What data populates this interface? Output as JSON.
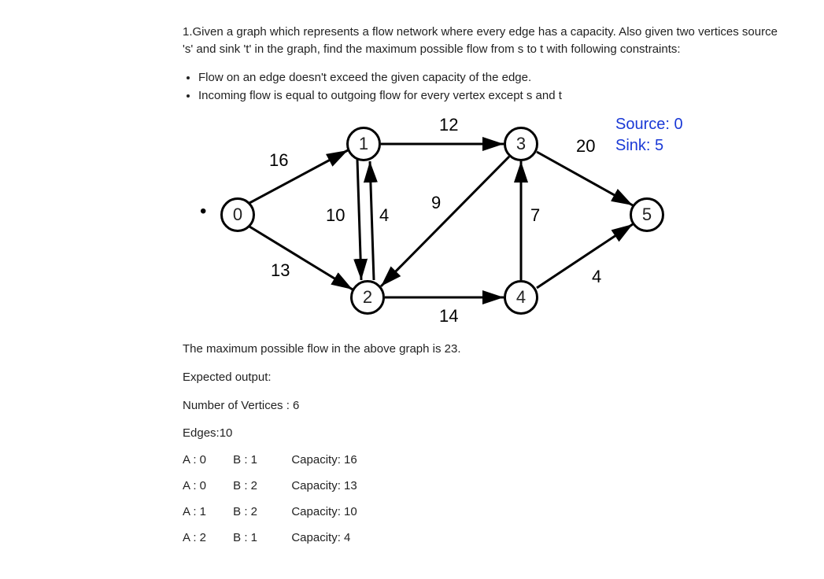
{
  "problem": {
    "intro": "1.Given a graph which represents a flow network where every edge has a capacity. Also given two vertices source 's' and sink 't' in the graph, find the maximum possible flow from s to t with following constraints:",
    "constraints": [
      "Flow on an edge doesn't exceed the given capacity of the edge.",
      "Incoming flow is equal to outgoing flow for every vertex except s and t"
    ]
  },
  "diagram": {
    "source_label": "Source: 0",
    "sink_label": "Sink: 5",
    "nodes": {
      "n0": "0",
      "n1": "1",
      "n2": "2",
      "n3": "3",
      "n4": "4",
      "n5": "5"
    },
    "edge_weights": {
      "e0_1": "16",
      "e0_2": "13",
      "e1_2": "10",
      "e2_1": "4",
      "e1_3": "12",
      "e3_2": "9",
      "e2_4": "14",
      "e4_3": "7",
      "e3_5": "20",
      "e4_5": "4"
    }
  },
  "result": {
    "maxflow_text": "The maximum possible flow in the above graph is 23.",
    "expected_label": "Expected output:",
    "vertices_line": "Number of Vertices : 6",
    "edges_line": "Edges:10",
    "edges_table": [
      {
        "a": "A : 0",
        "b": "B : 1",
        "cap": "Capacity: 16"
      },
      {
        "a": "A : 0",
        "b": "B : 2",
        "cap": "Capacity: 13"
      },
      {
        "a": "A : 1",
        "b": "B : 2",
        "cap": "Capacity: 10"
      },
      {
        "a": "A : 2",
        "b": "B : 1",
        "cap": "Capacity: 4"
      }
    ]
  },
  "chart_data": {
    "type": "diagram",
    "graph_kind": "directed_flow_network",
    "source": 0,
    "sink": 5,
    "vertices": [
      0,
      1,
      2,
      3,
      4,
      5
    ],
    "edges": [
      {
        "from": 0,
        "to": 1,
        "capacity": 16
      },
      {
        "from": 0,
        "to": 2,
        "capacity": 13
      },
      {
        "from": 1,
        "to": 2,
        "capacity": 10
      },
      {
        "from": 2,
        "to": 1,
        "capacity": 4
      },
      {
        "from": 1,
        "to": 3,
        "capacity": 12
      },
      {
        "from": 3,
        "to": 2,
        "capacity": 9
      },
      {
        "from": 2,
        "to": 4,
        "capacity": 14
      },
      {
        "from": 4,
        "to": 3,
        "capacity": 7
      },
      {
        "from": 3,
        "to": 5,
        "capacity": 20
      },
      {
        "from": 4,
        "to": 5,
        "capacity": 4
      }
    ],
    "max_flow": 23
  }
}
